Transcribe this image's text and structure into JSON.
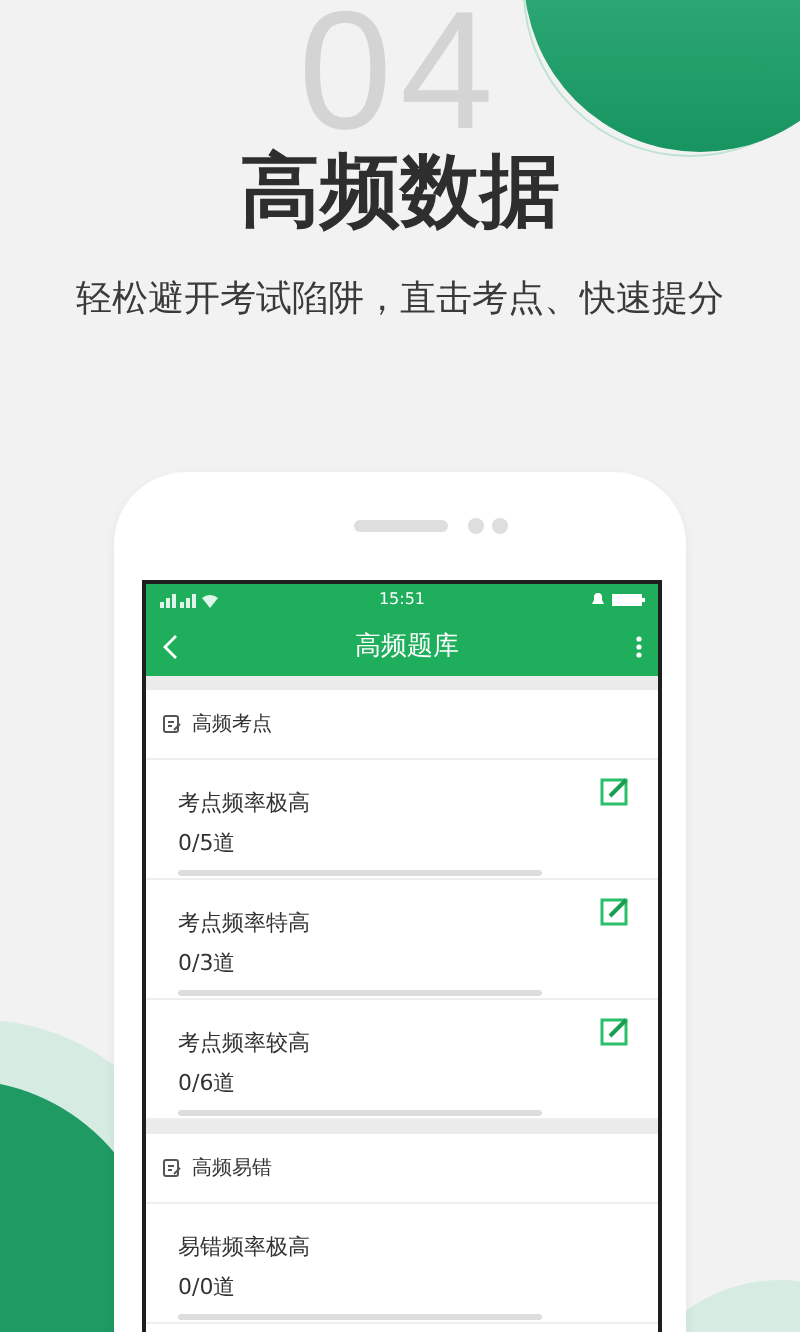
{
  "background_number": "04",
  "title": "高频数据",
  "subtitle": "轻松避开考试陷阱，直击考点、快速提分",
  "phone": {
    "status_bar": {
      "time": "15:51"
    },
    "header": {
      "title": "高频题库"
    },
    "sections": [
      {
        "title": "高频考点",
        "rows": [
          {
            "title": "考点频率极高",
            "count": "0/5道",
            "level": 0,
            "editable": true
          },
          {
            "title": "考点频率特高",
            "count": "0/3道",
            "level": 0,
            "editable": true
          },
          {
            "title": "考点频率较高",
            "count": "0/6道",
            "level": 0,
            "editable": true
          }
        ]
      },
      {
        "title": "高频易错",
        "rows": [
          {
            "title": "易错频率极高",
            "count": "0/0道",
            "level": 0,
            "editable": false
          }
        ]
      }
    ]
  }
}
